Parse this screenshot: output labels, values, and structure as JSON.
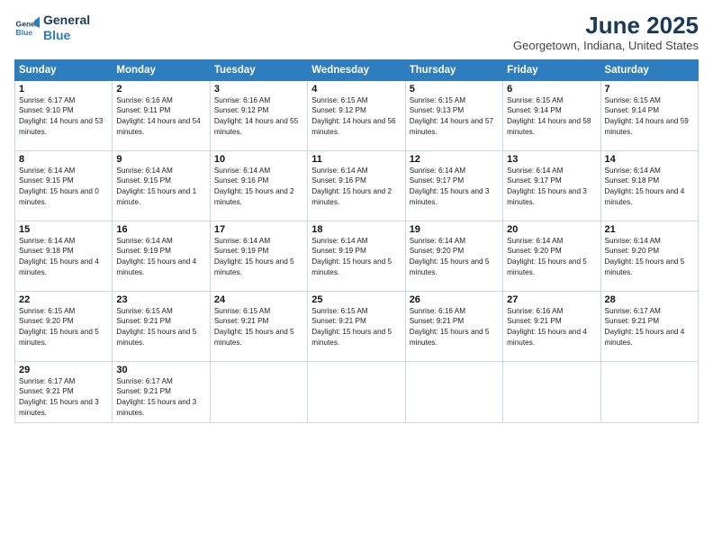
{
  "header": {
    "logo_line1": "General",
    "logo_line2": "Blue",
    "title": "June 2025",
    "location": "Georgetown, Indiana, United States"
  },
  "columns": [
    "Sunday",
    "Monday",
    "Tuesday",
    "Wednesday",
    "Thursday",
    "Friday",
    "Saturday"
  ],
  "weeks": [
    [
      {
        "day": "1",
        "sunrise": "6:17 AM",
        "sunset": "9:10 PM",
        "daylight": "14 hours and 53 minutes."
      },
      {
        "day": "2",
        "sunrise": "6:16 AM",
        "sunset": "9:11 PM",
        "daylight": "14 hours and 54 minutes."
      },
      {
        "day": "3",
        "sunrise": "6:16 AM",
        "sunset": "9:12 PM",
        "daylight": "14 hours and 55 minutes."
      },
      {
        "day": "4",
        "sunrise": "6:15 AM",
        "sunset": "9:12 PM",
        "daylight": "14 hours and 56 minutes."
      },
      {
        "day": "5",
        "sunrise": "6:15 AM",
        "sunset": "9:13 PM",
        "daylight": "14 hours and 57 minutes."
      },
      {
        "day": "6",
        "sunrise": "6:15 AM",
        "sunset": "9:14 PM",
        "daylight": "14 hours and 58 minutes."
      },
      {
        "day": "7",
        "sunrise": "6:15 AM",
        "sunset": "9:14 PM",
        "daylight": "14 hours and 59 minutes."
      }
    ],
    [
      {
        "day": "8",
        "sunrise": "6:14 AM",
        "sunset": "9:15 PM",
        "daylight": "15 hours and 0 minutes."
      },
      {
        "day": "9",
        "sunrise": "6:14 AM",
        "sunset": "9:15 PM",
        "daylight": "15 hours and 1 minute."
      },
      {
        "day": "10",
        "sunrise": "6:14 AM",
        "sunset": "9:16 PM",
        "daylight": "15 hours and 2 minutes."
      },
      {
        "day": "11",
        "sunrise": "6:14 AM",
        "sunset": "9:16 PM",
        "daylight": "15 hours and 2 minutes."
      },
      {
        "day": "12",
        "sunrise": "6:14 AM",
        "sunset": "9:17 PM",
        "daylight": "15 hours and 3 minutes."
      },
      {
        "day": "13",
        "sunrise": "6:14 AM",
        "sunset": "9:17 PM",
        "daylight": "15 hours and 3 minutes."
      },
      {
        "day": "14",
        "sunrise": "6:14 AM",
        "sunset": "9:18 PM",
        "daylight": "15 hours and 4 minutes."
      }
    ],
    [
      {
        "day": "15",
        "sunrise": "6:14 AM",
        "sunset": "9:18 PM",
        "daylight": "15 hours and 4 minutes."
      },
      {
        "day": "16",
        "sunrise": "6:14 AM",
        "sunset": "9:19 PM",
        "daylight": "15 hours and 4 minutes."
      },
      {
        "day": "17",
        "sunrise": "6:14 AM",
        "sunset": "9:19 PM",
        "daylight": "15 hours and 5 minutes."
      },
      {
        "day": "18",
        "sunrise": "6:14 AM",
        "sunset": "9:19 PM",
        "daylight": "15 hours and 5 minutes."
      },
      {
        "day": "19",
        "sunrise": "6:14 AM",
        "sunset": "9:20 PM",
        "daylight": "15 hours and 5 minutes."
      },
      {
        "day": "20",
        "sunrise": "6:14 AM",
        "sunset": "9:20 PM",
        "daylight": "15 hours and 5 minutes."
      },
      {
        "day": "21",
        "sunrise": "6:14 AM",
        "sunset": "9:20 PM",
        "daylight": "15 hours and 5 minutes."
      }
    ],
    [
      {
        "day": "22",
        "sunrise": "6:15 AM",
        "sunset": "9:20 PM",
        "daylight": "15 hours and 5 minutes."
      },
      {
        "day": "23",
        "sunrise": "6:15 AM",
        "sunset": "9:21 PM",
        "daylight": "15 hours and 5 minutes."
      },
      {
        "day": "24",
        "sunrise": "6:15 AM",
        "sunset": "9:21 PM",
        "daylight": "15 hours and 5 minutes."
      },
      {
        "day": "25",
        "sunrise": "6:15 AM",
        "sunset": "9:21 PM",
        "daylight": "15 hours and 5 minutes."
      },
      {
        "day": "26",
        "sunrise": "6:16 AM",
        "sunset": "9:21 PM",
        "daylight": "15 hours and 5 minutes."
      },
      {
        "day": "27",
        "sunrise": "6:16 AM",
        "sunset": "9:21 PM",
        "daylight": "15 hours and 4 minutes."
      },
      {
        "day": "28",
        "sunrise": "6:17 AM",
        "sunset": "9:21 PM",
        "daylight": "15 hours and 4 minutes."
      }
    ],
    [
      {
        "day": "29",
        "sunrise": "6:17 AM",
        "sunset": "9:21 PM",
        "daylight": "15 hours and 3 minutes."
      },
      {
        "day": "30",
        "sunrise": "6:17 AM",
        "sunset": "9:21 PM",
        "daylight": "15 hours and 3 minutes."
      },
      null,
      null,
      null,
      null,
      null
    ]
  ]
}
